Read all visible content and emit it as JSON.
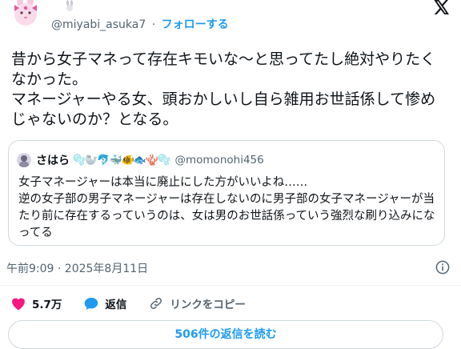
{
  "header": {
    "handle": "@miyabi_asuka7",
    "separator": "·",
    "follow_label": "フォローする"
  },
  "tweet": {
    "text": "昔から女子マネって存在キモいな～と思ってたし絶対やりたくなかった。\nマネージャーやる女、頭おかしいし自ら雑用お世話係して惨めじゃないのか？となる。"
  },
  "quote": {
    "name": "さはら",
    "emojis": "🫧🦭🐬🐳🐠🐟🪸🫧",
    "handle": "@momonohi456",
    "text": "女子マネージャーは本当に廃止にした方がいいよね……\n逆の女子部の男子マネージャーは存在しないのに男子部の女子マネージャーが当たり前に存在するっていうのは、女は男のお世話係っていう強烈な刷り込みになってる"
  },
  "meta": {
    "timestamp": "午前9:09 · 2025年8月11日"
  },
  "actions": {
    "likes": "5.7万",
    "reply_label": "返信",
    "copy_link_label": "リンクをコピー"
  },
  "replies_button": "506件の返信を読む",
  "colors": {
    "accent": "#1d9bf0",
    "like": "#f91880",
    "secondary_text": "#536471"
  }
}
